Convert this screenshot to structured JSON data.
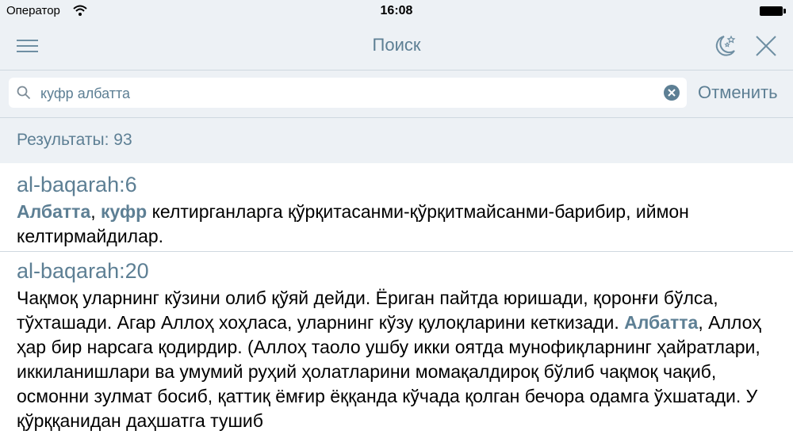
{
  "status": {
    "carrier": "Оператор",
    "time": "16:08"
  },
  "nav": {
    "title": "Поиск"
  },
  "search": {
    "query": "куфр албатта",
    "cancel_label": "Отменить"
  },
  "results": {
    "label": "Результаты: 93",
    "items": [
      {
        "ref": "al-baqarah:6",
        "hl1": "Албатта",
        "sep1": ", ",
        "hl2": "куфр",
        "rest": " келтирганларга қўрқитасанми-қўрқитмайсанми-барибир, иймон келтирмайдилар."
      },
      {
        "ref": "al-baqarah:20",
        "before": "Чақмоқ уларнинг кўзини олиб қўяй дейди. Ёриган пайтда юришади, қоронғи бўлса, тўхташади. Агар Аллоҳ хоҳласа, уларнинг кўзу қулоқларини кеткизади. ",
        "hl": "Албатта",
        "after": ", Аллоҳ ҳар бир нарсага қодирдир. (Аллоҳ таоло ушбу икки оятда мунофиқларнинг ҳайратлари, иккиланишлари ва умумий руҳий ҳолатларини момақалдироқ бўлиб чақмоқ чақиб, осмонни зулмат босиб, қаттиқ ёмғир ёққанда кўчада қолган бечора одамга ўхшатади. У қўрққанидан даҳшатга тушиб"
      }
    ]
  },
  "colors": {
    "accent": "#5d7f94",
    "bar_bg": "#edf1f5",
    "divider": "#cfd8e0"
  },
  "icons": [
    "wifi-icon",
    "battery-icon",
    "menu-icon",
    "night-mode-icon",
    "close-icon",
    "search-icon",
    "clear-icon"
  ]
}
